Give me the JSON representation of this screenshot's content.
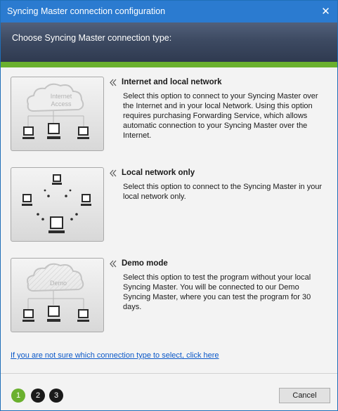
{
  "window": {
    "title": "Syncing Master connection configuration",
    "close_icon": "close-icon"
  },
  "header": {
    "heading": "Choose Syncing Master connection type:"
  },
  "options": [
    {
      "title": "Internet and local network",
      "description": "Select this option to connect to your Syncing Master over the Internet and in your local Network. Using this option requires purchasing Forwarding Service, which allows automatic connection to your Syncing Master over the Internet.",
      "cloud_label_1": "Internet",
      "cloud_label_2": "Access"
    },
    {
      "title": "Local network only",
      "description": "Select this option to connect to the Syncing Master in your local network only."
    },
    {
      "title": "Demo mode",
      "description": "Select this option to test the program without your local Syncing Master. You will be connected to our Demo Syncing Master, where you can test the program for 30 days.",
      "cloud_label": "Demo"
    }
  ],
  "help_link": "If you are not sure which connection type to select, click here",
  "steps": [
    "1",
    "2",
    "3"
  ],
  "active_step": "1",
  "cancel_label": "Cancel",
  "colors": {
    "titlebar": "#2b7bd0",
    "header": "#3d4a62",
    "accent_green": "#6ab02e",
    "link": "#0b58c8"
  }
}
